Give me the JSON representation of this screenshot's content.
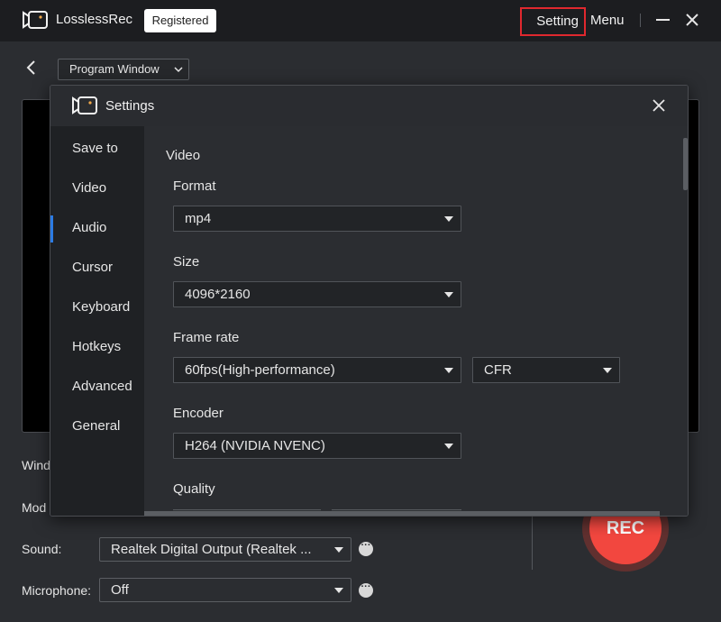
{
  "app": {
    "name": "LosslessRec",
    "badge": "Registered",
    "setting_label": "Setting",
    "menu_label": "Menu"
  },
  "toolbar": {
    "program_select": "Program Window"
  },
  "main": {
    "labels": {
      "window": "Wind",
      "mode": "Mod",
      "sound": "Sound:",
      "microphone": "Microphone:"
    },
    "sound_value": "Realtek Digital Output (Realtek ...",
    "microphone_value": "Off",
    "rec_label": "REC"
  },
  "settings": {
    "title": "Settings",
    "nav": [
      "Save to",
      "Video",
      "Audio",
      "Cursor",
      "Keyboard",
      "Hotkeys",
      "Advanced",
      "General"
    ],
    "active_nav": "Video",
    "section": "Video",
    "fields": {
      "format_label": "Format",
      "format_value": "mp4",
      "size_label": "Size",
      "size_value": "4096*2160",
      "framerate_label": "Frame rate",
      "framerate_value": "60fps(High-performance)",
      "framerate_mode": "CFR",
      "encoder_label": "Encoder",
      "encoder_value": "H264 (NVIDIA NVENC)",
      "quality_label": "Quality"
    }
  },
  "colors": {
    "accent": "#2b7be4",
    "rec": "#f2473f",
    "highlight_border": "#e0282e"
  }
}
